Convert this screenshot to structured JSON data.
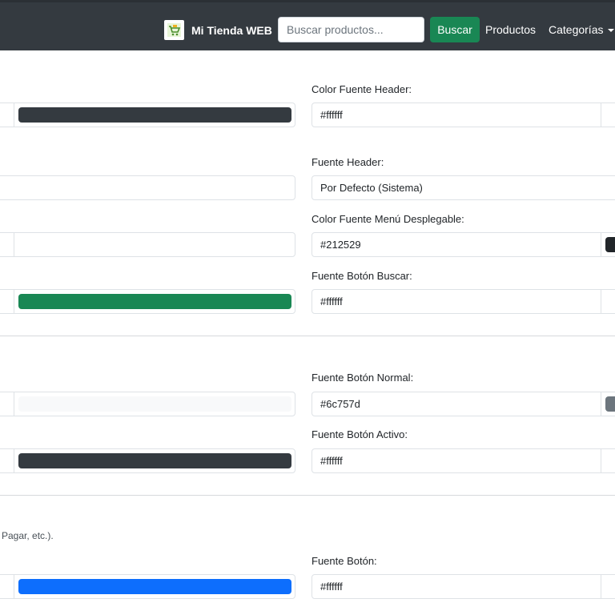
{
  "header": {
    "brand": "Mi Tienda WEB",
    "search_placeholder": "Buscar productos...",
    "search_button": "Buscar",
    "nav_productos": "Productos",
    "nav_categorias": "Categorías"
  },
  "colors": {
    "navbar": "#343a40",
    "search_button": "#198754",
    "swatch_header": "#343a40",
    "swatch_buscar": "#198754",
    "swatch_normal": "#f8f9fa",
    "swatch_activo": "#343a40",
    "swatch_boton": "#0d6efd"
  },
  "form": {
    "color_fuente_header": {
      "label": "Color Fuente Header:",
      "value": "#ffffff"
    },
    "fuente_header": {
      "label": "Fuente Header:",
      "value": "Por Defecto (Sistema)"
    },
    "color_fuente_menu": {
      "label": "Color Fuente Menú Desplegable:",
      "value": "#212529"
    },
    "fuente_boton_buscar": {
      "label": "Fuente Botón Buscar:",
      "value": "#ffffff"
    },
    "fuente_boton_normal": {
      "label": "Fuente Botón Normal:",
      "value": "#6c757d"
    },
    "fuente_boton_activo": {
      "label": "Fuente Botón Activo:",
      "value": "#ffffff"
    },
    "fuente_boton": {
      "label": "Fuente Botón:",
      "value": "#ffffff"
    }
  },
  "notes": {
    "buttons_hint": "Pagar, etc.)."
  }
}
